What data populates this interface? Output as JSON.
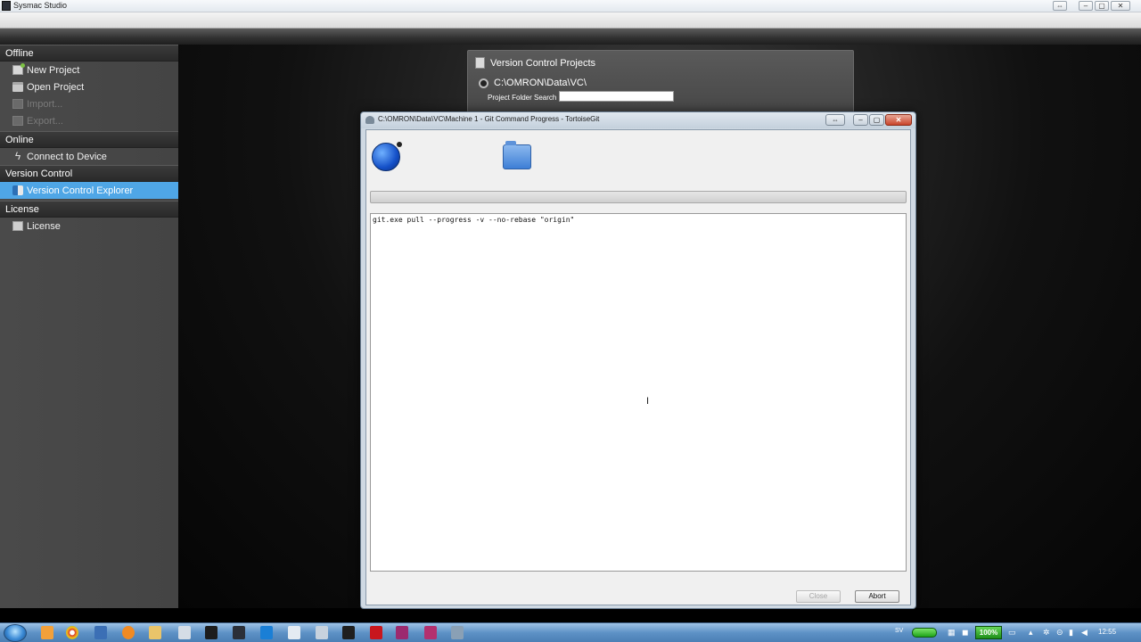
{
  "app": {
    "title": "Sysmac Studio"
  },
  "sidebar": {
    "sections": [
      {
        "heading": "Offline",
        "items": [
          {
            "label": "New Project",
            "icon": "new-project-icon",
            "enabled": true
          },
          {
            "label": "Open Project",
            "icon": "open-project-icon",
            "enabled": true
          },
          {
            "label": "Import...",
            "icon": "import-icon",
            "enabled": false
          },
          {
            "label": "Export...",
            "icon": "export-icon",
            "enabled": false
          }
        ]
      },
      {
        "heading": "Online",
        "items": [
          {
            "label": "Connect to Device",
            "icon": "lightning-icon",
            "enabled": true
          }
        ]
      },
      {
        "heading": "Version Control",
        "items": [
          {
            "label": "Version Control Explorer",
            "icon": "version-control-icon",
            "enabled": true,
            "selected": true
          }
        ]
      },
      {
        "heading": "License",
        "items": [
          {
            "label": "License",
            "icon": "license-icon",
            "enabled": true
          }
        ]
      }
    ]
  },
  "vc_panel": {
    "title": "Version Control Projects",
    "path": "C:\\OMRON\\Data\\VC\\",
    "search_label": "Project Folder Search",
    "search_value": ""
  },
  "dialog": {
    "title": "C:\\OMRON\\Data\\VC\\Machine 1 - Git Command Progress - TortoiseGit",
    "log_text": "git.exe pull --progress -v --no-rebase \"origin\"",
    "close_button": "Close",
    "abort_button": "Abort"
  },
  "taskbar": {
    "language": "SV",
    "battery": "100%",
    "clock": "12:55"
  },
  "colors": {
    "sidebar_selected": "#4fa6e6",
    "taskbar": "#5e92c6"
  }
}
